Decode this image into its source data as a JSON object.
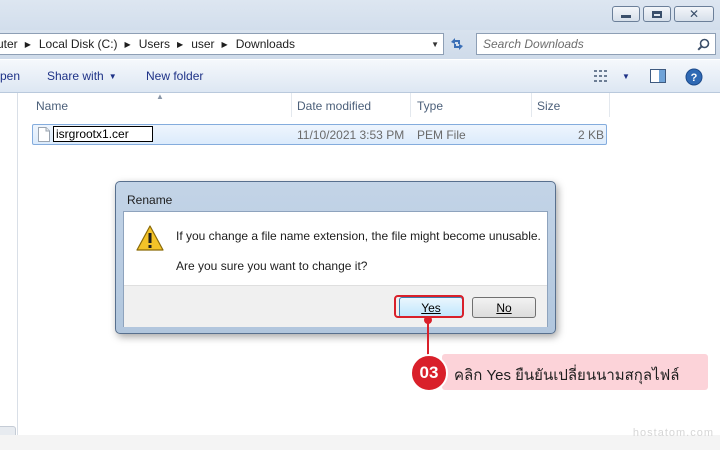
{
  "window": {
    "controls": {
      "minimize_icon": "minimize-icon",
      "maximize_icon": "maximize-icon",
      "close_icon": "close-icon"
    }
  },
  "address": {
    "crumbs": [
      "uter",
      "Local Disk (C:)",
      "Users",
      "user",
      "Downloads"
    ],
    "search_placeholder": "Search Downloads"
  },
  "toolbar": {
    "open_label": "pen",
    "share_label": "Share with",
    "new_folder_label": "New folder"
  },
  "columns": {
    "name": "Name",
    "date": "Date modified",
    "type": "Type",
    "size": "Size"
  },
  "file": {
    "name": "isrgrootx1.cer",
    "date": "11/10/2021 3:53 PM",
    "type": "PEM File",
    "size": "2 KB"
  },
  "dialog": {
    "title": "Rename",
    "message": "If you change a file name extension, the file might become unusable.",
    "question": "Are you sure you want to change it?",
    "yes_label": "Yes",
    "no_label": "No"
  },
  "annotation": {
    "step": "03",
    "text": "คลิก Yes ยืนยันเปลี่ยนนามสกุลไฟล์",
    "color": "#d9202a",
    "bg_color": "#fcd3d9"
  },
  "watermark": "hostatom.com"
}
